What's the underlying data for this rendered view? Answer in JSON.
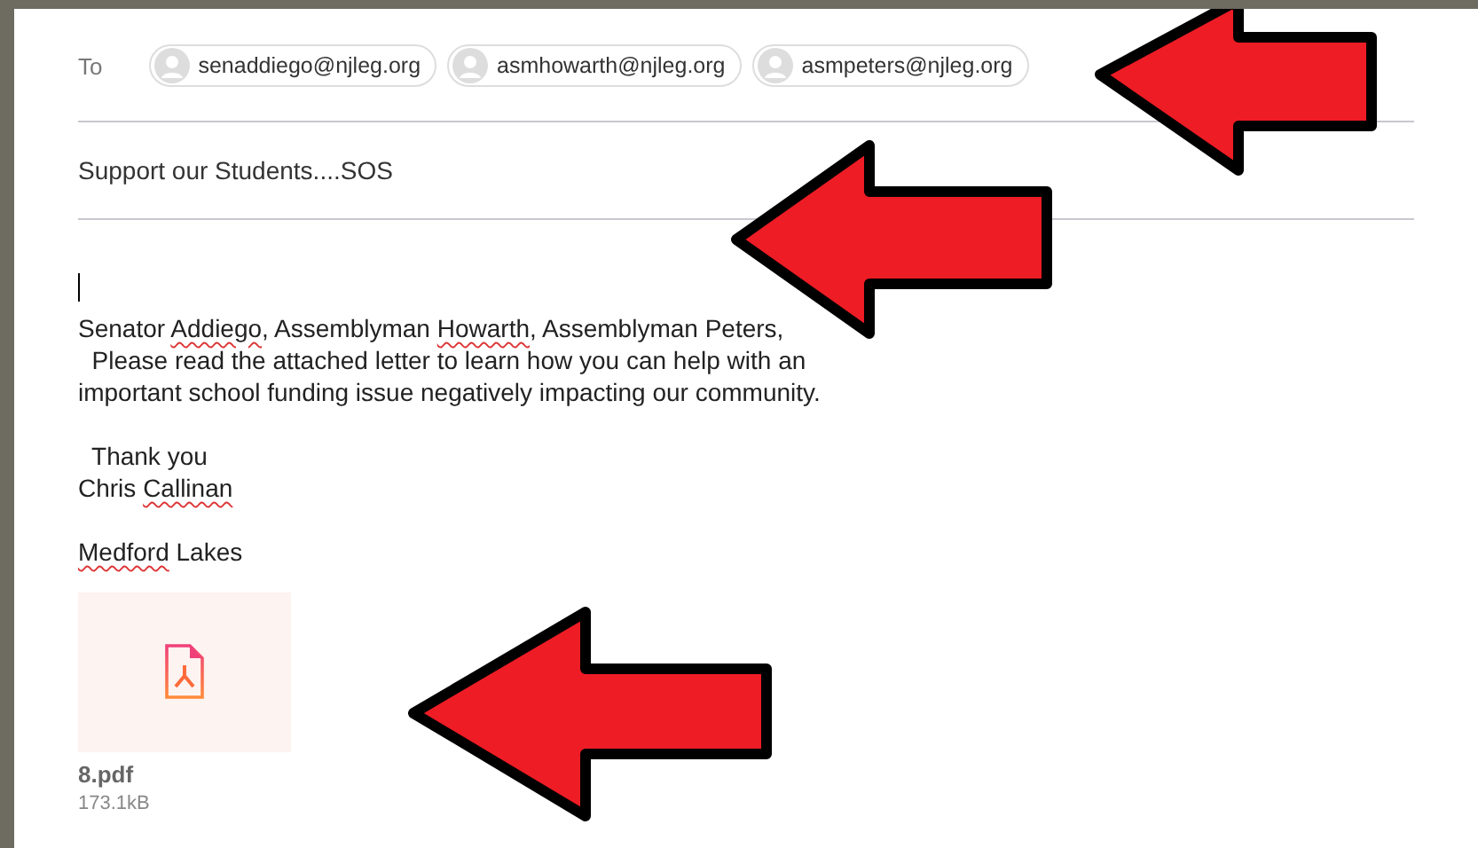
{
  "to_label": "To",
  "recipients": [
    "senaddiego@njleg.org",
    "asmhowarth@njleg.org",
    "asmpeters@njleg.org"
  ],
  "subject": "Support our Students....SOS",
  "body": [
    [
      [
        {
          "text": "Senator "
        },
        {
          "text": "Addiego",
          "misspelled": true
        },
        {
          "text": ", Assemblyman "
        },
        {
          "text": "Howarth",
          "misspelled": true
        },
        {
          "text": ", Assemblyman Peters,"
        }
      ],
      [
        {
          "text": "  Please read the attached letter to learn how you can help with an"
        }
      ],
      [
        {
          "text": "important school funding issue negatively impacting our community."
        }
      ]
    ],
    [
      [
        {
          "text": "  Thank you"
        }
      ],
      [
        {
          "text": "Chris "
        },
        {
          "text": "Callinan",
          "misspelled": true
        }
      ]
    ],
    [
      [
        {
          "text": "Medford",
          "misspelled": true
        },
        {
          "text": " Lakes"
        }
      ]
    ]
  ],
  "attachment": {
    "name": "8.pdf",
    "size": "173.1kB"
  }
}
